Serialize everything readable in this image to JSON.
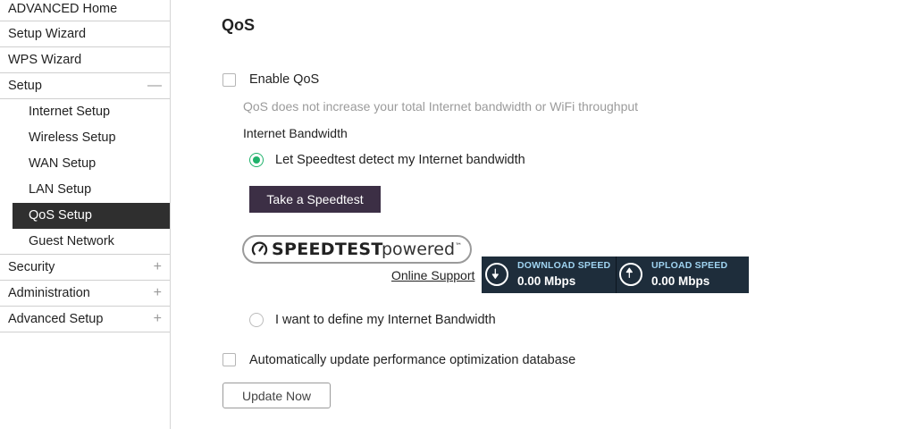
{
  "sidebar": {
    "items": [
      {
        "label": "ADVANCED Home"
      },
      {
        "label": "Setup Wizard"
      },
      {
        "label": "WPS Wizard"
      },
      {
        "label": "Setup",
        "sign": "—"
      },
      {
        "label": "Internet Setup"
      },
      {
        "label": "Wireless Setup"
      },
      {
        "label": "WAN Setup"
      },
      {
        "label": "LAN Setup"
      },
      {
        "label": "QoS Setup",
        "active": true
      },
      {
        "label": "Guest Network"
      },
      {
        "label": "Security",
        "sign": "+"
      },
      {
        "label": "Administration",
        "sign": "+"
      },
      {
        "label": "Advanced Setup",
        "sign": "+"
      }
    ]
  },
  "main": {
    "title": "QoS",
    "enable_qos": {
      "label": "Enable QoS",
      "checked": false
    },
    "hint": "QoS does not increase your total Internet bandwidth or WiFi throughput",
    "bandwidth_label": "Internet Bandwidth",
    "option_speedtest": {
      "label": "Let Speedtest detect my Internet bandwidth",
      "selected": true
    },
    "take_speedtest_button": "Take a Speedtest",
    "speedtest_logo": {
      "brand": "SPEEDTEST",
      "suffix": "powered",
      "tm": "™"
    },
    "online_support": "Online Support",
    "speed_widget": {
      "download_label": "DOWNLOAD SPEED",
      "download_value": "0.00 Mbps",
      "upload_label": "UPLOAD SPEED",
      "upload_value": "0.00 Mbps"
    },
    "option_manual": {
      "label": "I want to define my Internet Bandwidth",
      "selected": false
    },
    "auto_update": {
      "label": "Automatically update performance optimization database",
      "checked": false
    },
    "update_now_button": "Update Now"
  },
  "colors": {
    "active_nav_bg": "#2f2f2f",
    "primary_button": "#3c2f45",
    "radio_accent": "#20b26b",
    "speed_widget_bg": "#1e2d3b",
    "speed_label": "#9fd3f0"
  }
}
